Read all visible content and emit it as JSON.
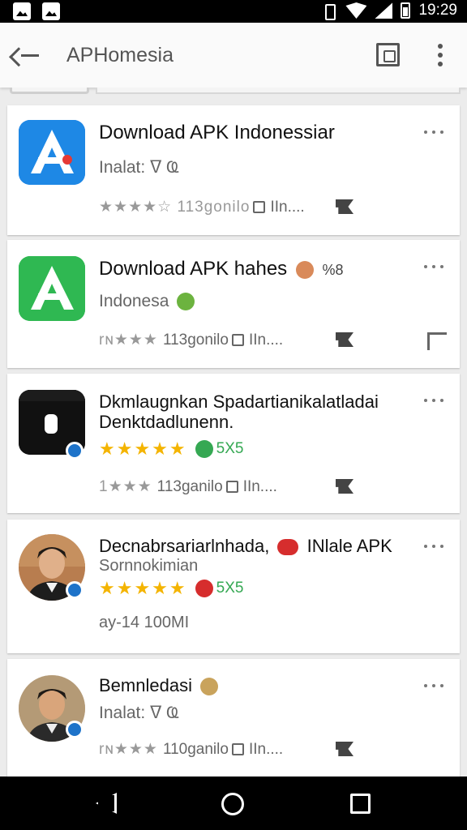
{
  "status_bar": {
    "time": "19:29",
    "icons": [
      "photo-icon",
      "image-icon",
      "vibrate-icon",
      "wifi-icon",
      "signal-icon",
      "battery-icon"
    ]
  },
  "toolbar": {
    "title": "APHomesia",
    "icons": [
      "back-arrow-icon",
      "screenshot-icon",
      "more-vert-icon"
    ]
  },
  "results": [
    {
      "title": "Download APK Indonessiar",
      "subtitle": "Inalat: ᐁ Ҩ",
      "meta": "★★★★☆ 113gonilo",
      "meta_suffix": "IIn....",
      "icon_color": "#1a73e8"
    },
    {
      "title": "Download APK hahes",
      "title_suffix": "%8",
      "subtitle": "Indonesa",
      "meta": "113gonilo",
      "meta_prefix": "rɴ★★★",
      "meta_suffix": "IIn....",
      "icon_color": "#2fb852"
    },
    {
      "title": "Dkmlaugnkan Spadartianikalatladai",
      "title_line2": "Denktdadlunenn.",
      "rating_text": "5X5",
      "meta": "113ganilo",
      "meta_prefix": "1★★★",
      "meta_suffix": "IIn....",
      "icon_color": "#111111"
    },
    {
      "title": "Decnabrsariarlnhada,",
      "title_suffix": "INlale APK",
      "subtitle": "Sornnokimian",
      "rating_text": "5X5",
      "meta": "ay-14 100MI"
    },
    {
      "title": "Bemnledasi",
      "subtitle": "Inalat: ᐁ Ҩ",
      "meta": "110ganilo",
      "meta_prefix": "rɴ★★★",
      "meta_suffix": "IIn...."
    }
  ],
  "colors": {
    "accent_blue": "#1e73c9",
    "star_gold": "#f4b400",
    "status_black": "#000000"
  }
}
